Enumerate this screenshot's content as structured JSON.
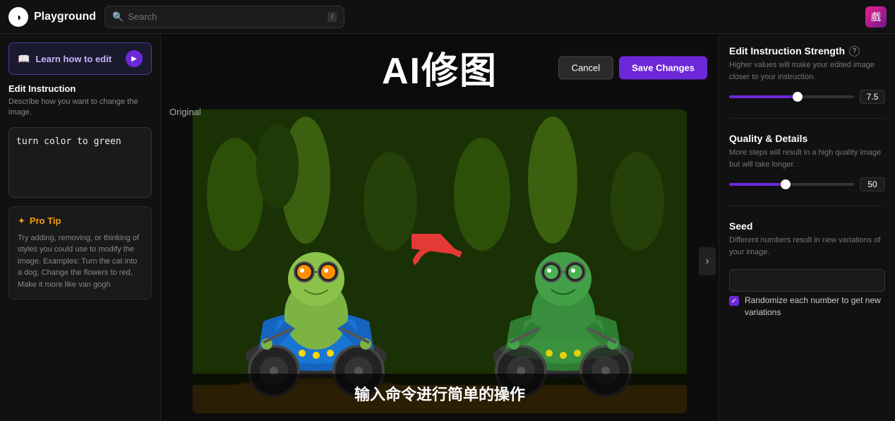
{
  "topnav": {
    "logo_icon": "◑",
    "title": "Playground",
    "search_placeholder": "Search",
    "search_shortcut": "/",
    "avatar_emoji": "戲"
  },
  "left_sidebar": {
    "learn_btn_label": "Learn how to edit",
    "learn_play_icon": "▶",
    "edit_instruction_title": "Edit Instruction",
    "edit_instruction_desc": "Describe how you want to change the image.",
    "edit_instruction_value": "turn color to green",
    "pro_tip_title": "Pro Tip",
    "pro_tip_text": "Try adding, removing, or thinking of styles you could use to modify the image. Examples: Turn the cat into a dog, Change the flowers to red, Make it more like van gogh"
  },
  "canvas": {
    "title": "AI修图",
    "cancel_label": "Cancel",
    "save_label": "Save Changes",
    "original_label": "Original",
    "caption": "输入命令进行简单的操作"
  },
  "right_sidebar": {
    "strength_title": "Edit Instruction Strength",
    "strength_desc": "Higher values will make your edited image closer to your instruction.",
    "strength_value": "7.5",
    "strength_percent": 55,
    "quality_title": "Quality & Details",
    "quality_desc": "More steps will result in a high quality image but will take longer.",
    "quality_value": "50",
    "quality_percent": 45,
    "seed_title": "Seed",
    "seed_desc": "Different numbers result in new variations of your image.",
    "seed_placeholder": "",
    "randomize_label": "Randomize each number to get new variations"
  }
}
